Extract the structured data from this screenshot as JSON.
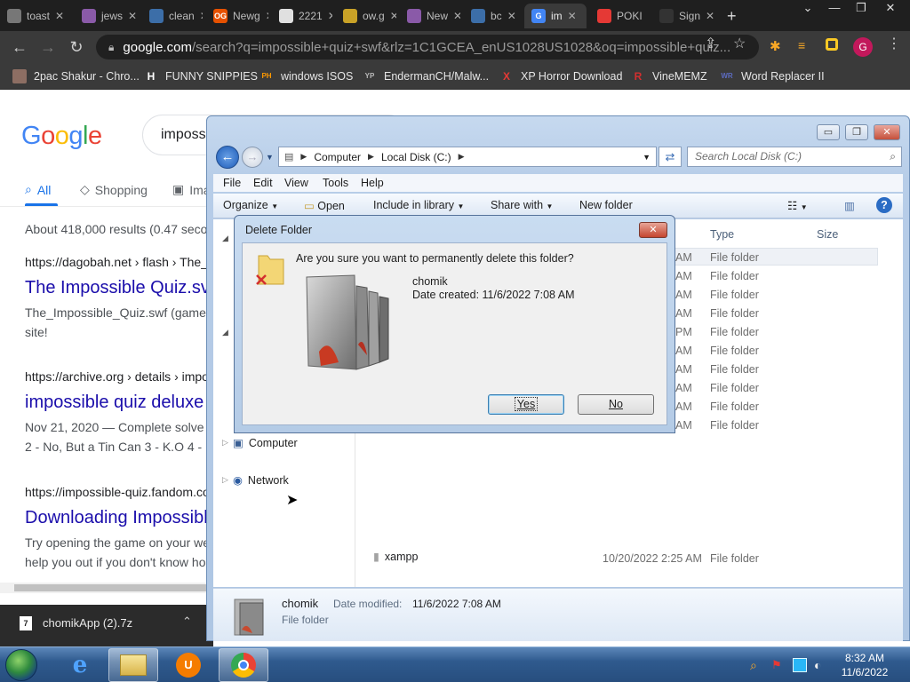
{
  "browser": {
    "tabs": [
      {
        "label": "toast",
        "color": "#777777"
      },
      {
        "label": "jews",
        "color": "#8a5aa8"
      },
      {
        "label": "clean",
        "color": "#3c6ea8"
      },
      {
        "label": "Newg",
        "color": "#e65100",
        "glyph": "OG"
      },
      {
        "label": "2221",
        "color": "#e0e0e0"
      },
      {
        "label": "ow.g",
        "color": "#c9a227"
      },
      {
        "label": "New",
        "color": "#8a5aa8"
      },
      {
        "label": "bc",
        "color": "#3c6ea8"
      },
      {
        "label": "im",
        "color": "#4285f4",
        "glyph": "G"
      },
      {
        "label": "POKI",
        "color": "#e53935"
      },
      {
        "label": "Sign",
        "color": "#333333"
      }
    ],
    "url_host": "google.com",
    "url_rest": "/search?q=impossible+quiz+swf&rlz=1C1GCEA_enUS1028US1028&oq=impossible+quiz...",
    "profile_initial": "G",
    "bookmarks": [
      {
        "label": "2pac Shakur - Chro...",
        "icon": "2pac-icon"
      },
      {
        "label": "FUNNY SNIPPIES",
        "icon": "H",
        "color": "#ffffff"
      },
      {
        "label": "windows ISOS",
        "icon": "PH",
        "color": "#ff9900"
      },
      {
        "label": "EndermanCH/Malw...",
        "icon": "YP",
        "color": "#bbbbbb"
      },
      {
        "label": "XP Horror Download",
        "icon": "X",
        "color": "#e53935"
      },
      {
        "label": "VineMEMZ",
        "icon": "R",
        "color": "#d32f2f"
      },
      {
        "label": "Word Replacer II",
        "icon": "WR",
        "color": "#5c6bc0"
      }
    ]
  },
  "google": {
    "logo": [
      "G",
      "o",
      "o",
      "g",
      "l",
      "e"
    ],
    "logo_colors": [
      "#4285f4",
      "#ea4335",
      "#fbbc05",
      "#4285f4",
      "#34a853",
      "#ea4335"
    ],
    "query": "imposs",
    "tab_all": "All",
    "tab_shopping": "Shopping",
    "tab_images": "Ima",
    "stats": "About 418,000 results (0.47 seco",
    "results": [
      {
        "cite": "https://dagobah.net › flash › The_",
        "title": "The Impossible Quiz.sv",
        "snippet1": "The_Impossible_Quiz.swf (game",
        "snippet2": "site!"
      },
      {
        "cite": "https://archive.org › details › impo",
        "title": "impossible quiz deluxe",
        "snippet1": "Nov 21, 2020 — Complete solve",
        "snippet2": "2 - No, But a Tin Can 3 - K.O 4 -"
      },
      {
        "cite": "https://impossible-quiz.fandom.co",
        "title": "Downloading Impossibl",
        "snippet1": "Try opening the game on your we",
        "snippet2": "help you out if you don't know ho"
      }
    ],
    "download_item": "chomikApp (2).7z"
  },
  "explorer": {
    "address": [
      "Computer",
      "Local Disk (C:)"
    ],
    "search_placeholder": "Search Local Disk (C:)",
    "menu": [
      "File",
      "Edit",
      "View",
      "Tools",
      "Help"
    ],
    "commands": {
      "organize": "Organize",
      "open": "Open",
      "include": "Include in library",
      "share": "Share with",
      "new_folder": "New folder"
    },
    "columns": {
      "type": "Type",
      "size": "Size"
    },
    "rows": [
      {
        "time": "AM",
        "type": "File folder"
      },
      {
        "time": "AM",
        "type": "File folder"
      },
      {
        "time": "AM",
        "type": "File folder"
      },
      {
        "time": "AM",
        "type": "File folder"
      },
      {
        "time": "PM",
        "type": "File folder"
      },
      {
        "time": "AM",
        "type": "File folder"
      },
      {
        "time": "AM",
        "type": "File folder"
      },
      {
        "time": "AM",
        "type": "File folder"
      },
      {
        "time": "AM",
        "type": "File folder"
      },
      {
        "time": "AM",
        "type": "File folder"
      }
    ],
    "last_row": {
      "name": "xampp",
      "date": "10/20/2022 2:25 AM",
      "type": "File folder"
    },
    "nav": {
      "computer": "Computer",
      "network": "Network"
    },
    "details": {
      "name": "chomik",
      "date_label": "Date modified:",
      "date_value": "11/6/2022 7:08 AM",
      "kind": "File folder"
    }
  },
  "dialog": {
    "title": "Delete Folder",
    "question": "Are you sure you want to permanently delete this folder?",
    "folder_name": "chomik",
    "date_created": "Date created: 11/6/2022 7:08 AM",
    "yes": "Yes",
    "no": "No"
  },
  "taskbar": {
    "time": "8:32 AM",
    "date": "11/6/2022"
  }
}
